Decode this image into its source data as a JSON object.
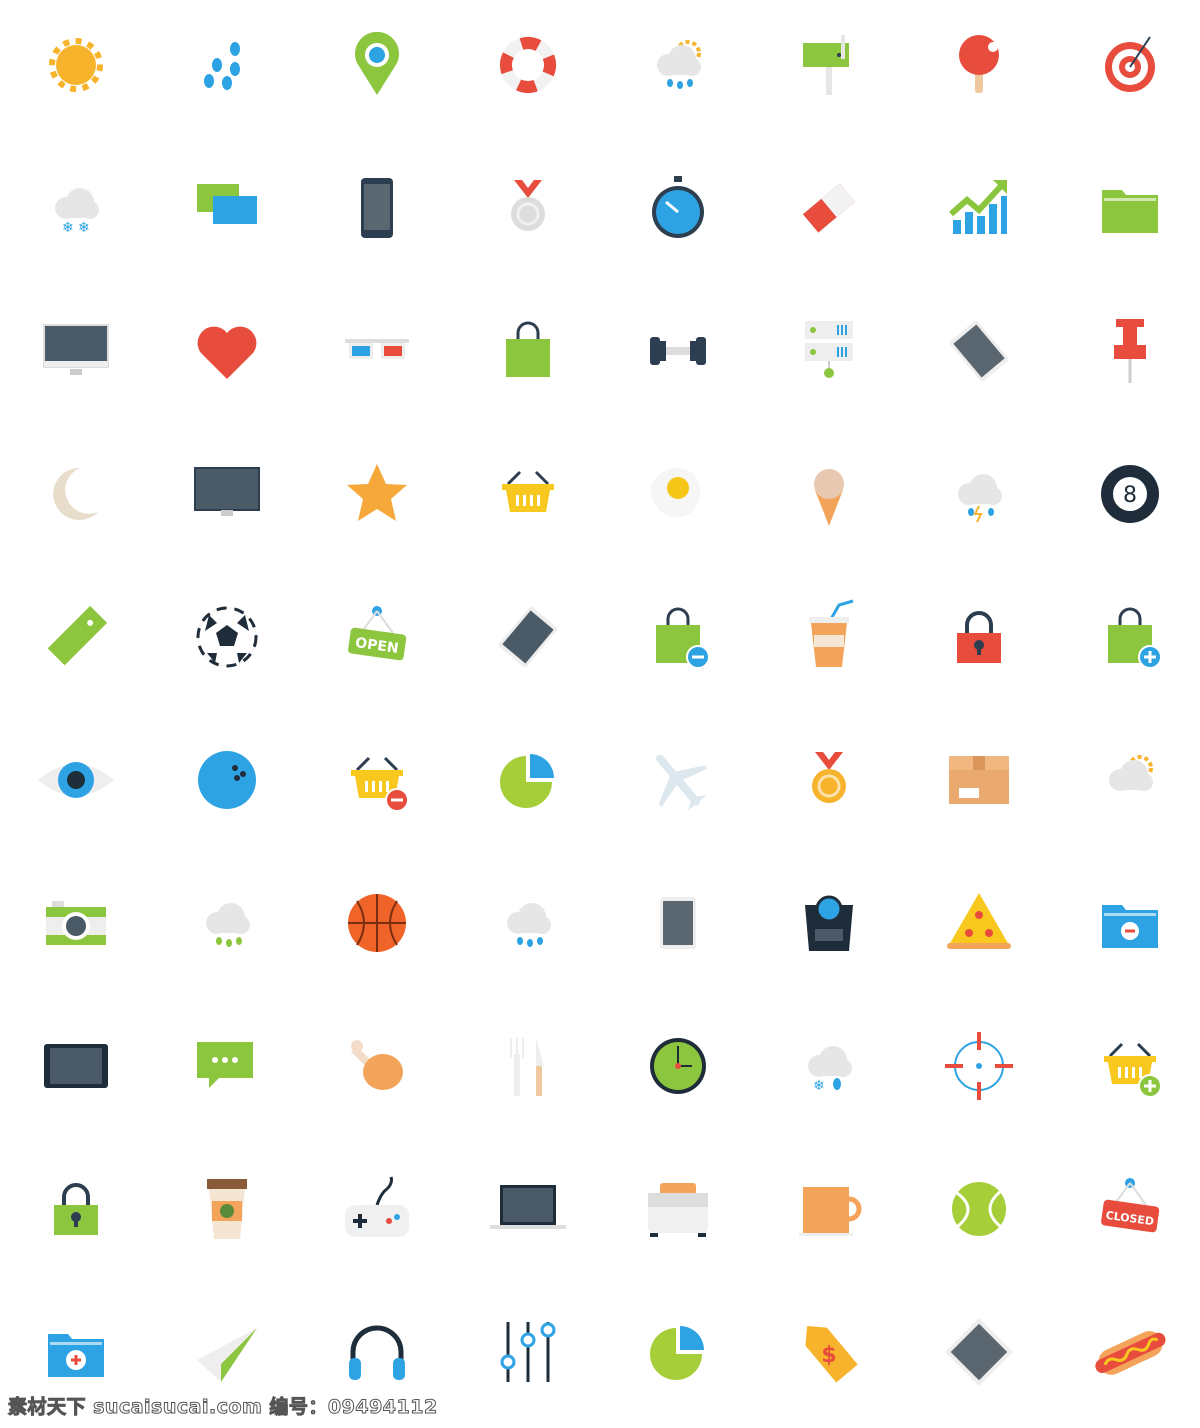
{
  "icons": [
    {
      "name": "gear",
      "color": "#f7b32b"
    },
    {
      "name": "raindrops",
      "color": "#2ea3e3"
    },
    {
      "name": "map-pin",
      "color": "#8cc63f",
      "color2": "#2ea3e3"
    },
    {
      "name": "lifebuoy",
      "color": "#e84c3d"
    },
    {
      "name": "cloud-sun-rain",
      "color": "#f0f0f0",
      "color2": "#2ea3e3"
    },
    {
      "name": "mailbox",
      "color": "#8cc63f"
    },
    {
      "name": "ping-pong-paddle",
      "color": "#e84c3d"
    },
    {
      "name": "target",
      "color": "#e84c3d"
    },
    {
      "name": "cloud-snow",
      "color": "#f0f0f0",
      "color2": "#2ea3e3"
    },
    {
      "name": "chat-bubbles",
      "color": "#8cc63f",
      "color2": "#2ea3e3"
    },
    {
      "name": "smartphone",
      "color": "#2c3e50"
    },
    {
      "name": "medal-silver",
      "color": "#dddddd",
      "color2": "#e84c3d"
    },
    {
      "name": "stopwatch",
      "color": "#2ea3e3"
    },
    {
      "name": "eraser",
      "color": "#e84c3d"
    },
    {
      "name": "growth-chart",
      "color": "#8cc63f",
      "color2": "#2ea3e3"
    },
    {
      "name": "folder",
      "color": "#8cc63f"
    },
    {
      "name": "monitor",
      "color": "#4a5a66"
    },
    {
      "name": "heart",
      "color": "#e84c3d"
    },
    {
      "name": "3d-glasses",
      "color": "#2ea3e3",
      "color2": "#e84c3d"
    },
    {
      "name": "shopping-bag",
      "color": "#8cc63f"
    },
    {
      "name": "dumbbell",
      "color": "#2c3e50"
    },
    {
      "name": "server",
      "color": "#eeeeee",
      "color2": "#8cc63f"
    },
    {
      "name": "phone-tilted",
      "color": "#5a6670"
    },
    {
      "name": "push-pin",
      "color": "#e84c3d"
    },
    {
      "name": "moon",
      "color": "#e8dccb"
    },
    {
      "name": "monitor-dark",
      "color": "#4a5a66"
    },
    {
      "name": "star",
      "color": "#f7a83b"
    },
    {
      "name": "basket",
      "color": "#f9c81e"
    },
    {
      "name": "fried-egg",
      "color": "#f5c518"
    },
    {
      "name": "ice-cream",
      "color": "#f3a45a",
      "color2": "#e8c8b0"
    },
    {
      "name": "cloud-thunder",
      "color": "#f0f0f0",
      "color2": "#f7b32b"
    },
    {
      "name": "eight-ball",
      "color": "#1f2d3a"
    },
    {
      "name": "price-tag",
      "color": "#8cc63f"
    },
    {
      "name": "soccer-ball",
      "color": "#1f2d3a"
    },
    {
      "name": "open-sign",
      "color": "#8cc63f",
      "color2": "#2ea3e3",
      "label": "OPEN"
    },
    {
      "name": "tablet-tilted",
      "color": "#4a5a66"
    },
    {
      "name": "bag-minus",
      "color": "#8cc63f",
      "color2": "#2ea3e3"
    },
    {
      "name": "drink-cup",
      "color": "#f3a45a",
      "color2": "#2ea3e3"
    },
    {
      "name": "padlock-red",
      "color": "#e84c3d"
    },
    {
      "name": "bag-plus",
      "color": "#8cc63f",
      "color2": "#2ea3e3"
    },
    {
      "name": "eye",
      "color": "#2ea3e3"
    },
    {
      "name": "bowling-ball",
      "color": "#2ea3e3"
    },
    {
      "name": "basket-minus",
      "color": "#f9c81e",
      "color2": "#e84c3d"
    },
    {
      "name": "pie-chart",
      "color": "#a6ce39",
      "color2": "#2ea3e3"
    },
    {
      "name": "airplane",
      "color": "#dde7ee"
    },
    {
      "name": "medal-gold",
      "color": "#f7b32b",
      "color2": "#e84c3d"
    },
    {
      "name": "cardboard-box",
      "color": "#e9a96f"
    },
    {
      "name": "cloud-sun",
      "color": "#f0f0f0",
      "color2": "#f7b32b"
    },
    {
      "name": "camera",
      "color": "#8cc63f"
    },
    {
      "name": "cloud-rain-green",
      "color": "#f0f0f0",
      "color2": "#8cc63f"
    },
    {
      "name": "basketball",
      "color": "#f0642a"
    },
    {
      "name": "cloud-rain",
      "color": "#f0f0f0",
      "color2": "#2ea3e3"
    },
    {
      "name": "tablet",
      "color": "#5a6670"
    },
    {
      "name": "weighing-scale",
      "color": "#1f2d3a",
      "color2": "#2ea3e3"
    },
    {
      "name": "pizza-slice",
      "color": "#f9c81e",
      "color2": "#e84c3d"
    },
    {
      "name": "folder-minus",
      "color": "#2ea3e3",
      "color2": "#e84c3d"
    },
    {
      "name": "tablet-landscape",
      "color": "#1f2d3a"
    },
    {
      "name": "chat-dots",
      "color": "#8cc63f"
    },
    {
      "name": "chicken-leg",
      "color": "#f3a45a"
    },
    {
      "name": "fork-knife",
      "color": "#eeeeee"
    },
    {
      "name": "clock",
      "color": "#8cc63f"
    },
    {
      "name": "cloud-snow-rain",
      "color": "#f0f0f0",
      "color2": "#2ea3e3"
    },
    {
      "name": "crosshair",
      "color": "#e84c3d",
      "color2": "#2ea3e3"
    },
    {
      "name": "basket-plus",
      "color": "#f9c81e",
      "color2": "#8cc63f"
    },
    {
      "name": "padlock-green",
      "color": "#8cc63f"
    },
    {
      "name": "coffee-cup",
      "color": "#f5e6d3",
      "color2": "#2ea3e3"
    },
    {
      "name": "gamepad",
      "color": "#f0f0f0"
    },
    {
      "name": "laptop",
      "color": "#4a5a66"
    },
    {
      "name": "toaster",
      "color": "#f0f0f0",
      "color2": "#f3a45a"
    },
    {
      "name": "mug",
      "color": "#f3a45a"
    },
    {
      "name": "tennis-ball",
      "color": "#a6ce39"
    },
    {
      "name": "closed-sign",
      "color": "#e84c3d",
      "color2": "#2ea3e3",
      "label": "CLOSED"
    },
    {
      "name": "folder-medical",
      "color": "#2ea3e3",
      "color2": "#e84c3d"
    },
    {
      "name": "paper-plane",
      "color": "#eeeeee",
      "color2": "#8cc63f"
    },
    {
      "name": "headphones",
      "color": "#1f2d3a",
      "color2": "#2ea3e3"
    },
    {
      "name": "equalizer-sliders",
      "color": "#2ea3e3"
    },
    {
      "name": "pie-chart-blue",
      "color": "#a6ce39",
      "color2": "#2ea3e3"
    },
    {
      "name": "dollar-tag",
      "color": "#f7b32b",
      "color2": "#e84c3d"
    },
    {
      "name": "tablet-diamond",
      "color": "#5a6670"
    },
    {
      "name": "hot-dog",
      "color": "#e84c3d",
      "color2": "#f9c81e"
    }
  ],
  "watermark": "素材天下 sucaisucai.com  编号：09494112"
}
